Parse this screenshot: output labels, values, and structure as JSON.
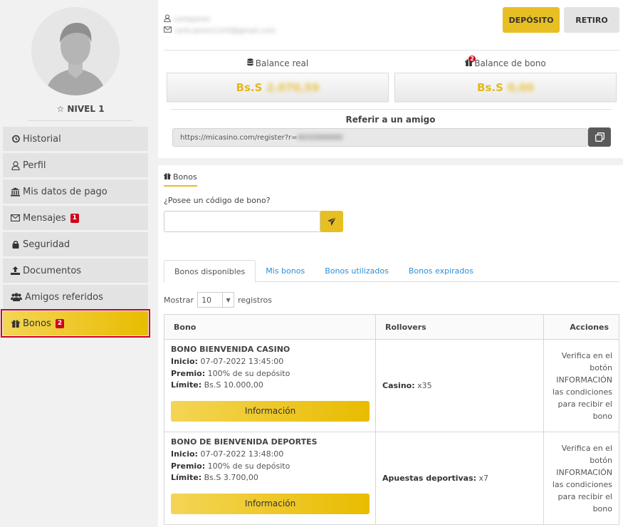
{
  "sidebar": {
    "level": "NIVEL 1",
    "items": [
      {
        "label": "Historial",
        "icon": "history-icon"
      },
      {
        "label": "Perfil",
        "icon": "user-icon"
      },
      {
        "label": "Mis datos de pago",
        "icon": "bank-icon"
      },
      {
        "label": "Mensajes",
        "icon": "envelope-icon",
        "badge": "1"
      },
      {
        "label": "Seguridad",
        "icon": "lock-icon"
      },
      {
        "label": "Documentos",
        "icon": "upload-icon"
      },
      {
        "label": "Amigos referidos",
        "icon": "users-icon"
      },
      {
        "label": "Bonos",
        "icon": "gift-icon",
        "badge": "2",
        "active": true
      }
    ]
  },
  "account": {
    "username": "carloperez",
    "email": "carlo.perez1103@gmail.com",
    "deposit_label": "DEPÓSITO",
    "withdraw_label": "RETIRO",
    "real_balance_label": "Balance real",
    "bonus_balance_label": "Balance de bono",
    "bonus_badge": "2",
    "currency": "Bs.S",
    "real_balance": "2.070,59",
    "bonus_balance": "0,00",
    "refer_title": "Referir a un amigo",
    "refer_prefix": "https://micasino.com/register?r=",
    "refer_code": "4032000000"
  },
  "bonus": {
    "section_label": "Bonos",
    "code_question": "¿Posee un código de bono?",
    "tabs": [
      "Bonos disponibles",
      "Mis bonos",
      "Bonos utilizados",
      "Bonos expirados"
    ],
    "show_label": "Mostrar",
    "show_value": "10",
    "records_label": "registros",
    "columns": [
      "Bono",
      "Rollovers",
      "Acciones"
    ],
    "rows": [
      {
        "name": "BONO BIENVENIDA CASINO",
        "start_label": "Inicio:",
        "start": "07-07-2022 13:45:00",
        "prize_label": "Premio:",
        "prize": "100% de su depósito",
        "limit_label": "Límite:",
        "limit": "Bs.S 10.000,00",
        "button": "Información",
        "rollover_label": "Casino:",
        "rollover": "x35",
        "action": [
          "Verifica en el",
          "botón",
          "INFORMACIÓN",
          "las condiciones",
          "para recibir el",
          "bono"
        ]
      },
      {
        "name": "BONO DE BIENVENIDA DEPORTES",
        "start_label": "Inicio:",
        "start": "07-07-2022 13:48:00",
        "prize_label": "Premio:",
        "prize": "100% de su depósito",
        "limit_label": "Límite:",
        "limit": "Bs.S 3.700,00",
        "button": "Información",
        "rollover_label": "Apuestas deportivas:",
        "rollover": "x7",
        "action": [
          "Verifica en el",
          "botón",
          "INFORMACIÓN",
          "las condiciones",
          "para recibir el",
          "bono"
        ]
      }
    ]
  },
  "colors": {
    "accent": "#e8bf22",
    "badge": "#d0021b",
    "link": "#2a8fd7"
  }
}
